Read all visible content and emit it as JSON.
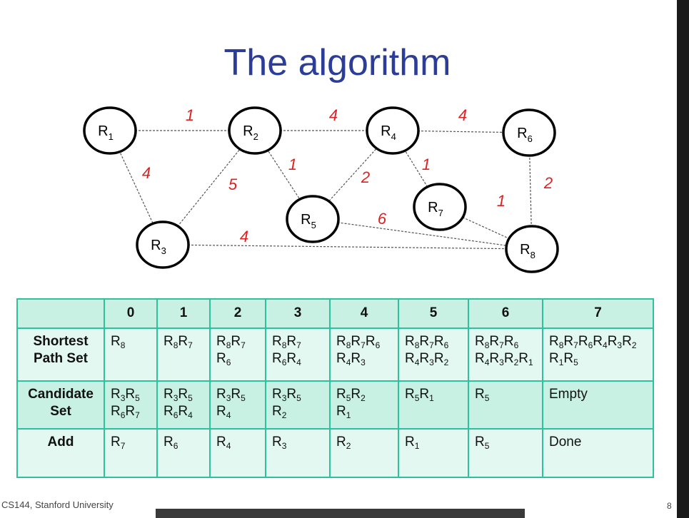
{
  "slide": {
    "title": "The algorithm",
    "footer_left": "CS144, Stanford University",
    "page_number": "8"
  },
  "graph": {
    "nodes": [
      {
        "id": "R1",
        "base": "R",
        "sub": "1"
      },
      {
        "id": "R2",
        "base": "R",
        "sub": "2"
      },
      {
        "id": "R3",
        "base": "R",
        "sub": "3"
      },
      {
        "id": "R4",
        "base": "R",
        "sub": "4"
      },
      {
        "id": "R5",
        "base": "R",
        "sub": "5"
      },
      {
        "id": "R6",
        "base": "R",
        "sub": "6"
      },
      {
        "id": "R7",
        "base": "R",
        "sub": "7"
      },
      {
        "id": "R8",
        "base": "R",
        "sub": "8"
      }
    ],
    "edges": [
      {
        "from": "R1",
        "to": "R2",
        "weight": "1"
      },
      {
        "from": "R1",
        "to": "R3",
        "weight": "4"
      },
      {
        "from": "R2",
        "to": "R3",
        "weight": "5"
      },
      {
        "from": "R2",
        "to": "R4",
        "weight": "4"
      },
      {
        "from": "R2",
        "to": "R5",
        "weight": "1"
      },
      {
        "from": "R3",
        "to": "R8",
        "weight": "4"
      },
      {
        "from": "R4",
        "to": "R5",
        "weight": "2"
      },
      {
        "from": "R4",
        "to": "R6",
        "weight": "4"
      },
      {
        "from": "R4",
        "to": "R7",
        "weight": "1"
      },
      {
        "from": "R5",
        "to": "R8",
        "weight": "6"
      },
      {
        "from": "R6",
        "to": "R8",
        "weight": "2"
      },
      {
        "from": "R7",
        "to": "R8",
        "weight": "1"
      }
    ]
  },
  "table": {
    "columns": [
      "0",
      "1",
      "2",
      "3",
      "4",
      "5",
      "6",
      "7"
    ],
    "rows": [
      {
        "label": [
          "Shortest",
          "Path Set"
        ],
        "cells": [
          [
            [
              "R8"
            ]
          ],
          [
            [
              "R8",
              "R7"
            ]
          ],
          [
            [
              "R8",
              "R7"
            ],
            [
              "R6"
            ]
          ],
          [
            [
              "R8",
              "R7"
            ],
            [
              "R6",
              "R4"
            ]
          ],
          [
            [
              "R8",
              "R7",
              "R6"
            ],
            [
              "R4",
              "R3"
            ]
          ],
          [
            [
              "R8",
              "R7",
              "R6"
            ],
            [
              "R4",
              "R3",
              "R2"
            ]
          ],
          [
            [
              "R8",
              "R7",
              "R6"
            ],
            [
              "R4",
              "R3",
              "R2",
              "R1"
            ]
          ],
          [
            [
              "R8",
              "R7",
              "R6",
              "R4",
              "R3",
              "R2"
            ],
            [
              "R1",
              "R5"
            ]
          ]
        ]
      },
      {
        "label": [
          "Candidate",
          "Set"
        ],
        "cells": [
          [
            [
              "R3",
              "R5"
            ],
            [
              "R6",
              "R7"
            ]
          ],
          [
            [
              "R3",
              "R5"
            ],
            [
              "R6",
              "R4"
            ]
          ],
          [
            [
              "R3",
              "R5"
            ],
            [
              "R4"
            ]
          ],
          [
            [
              "R3",
              "R5"
            ],
            [
              "R2"
            ]
          ],
          [
            [
              "R5",
              "R2"
            ],
            [
              "R1"
            ]
          ],
          [
            [
              "R5",
              "R1"
            ]
          ],
          [
            [
              "R5"
            ]
          ],
          [
            [
              "Empty"
            ]
          ]
        ]
      },
      {
        "label": [
          "Add"
        ],
        "cells": [
          [
            [
              "R7"
            ]
          ],
          [
            [
              "R6"
            ]
          ],
          [
            [
              "R4"
            ]
          ],
          [
            [
              "R3"
            ]
          ],
          [
            [
              "R2"
            ]
          ],
          [
            [
              "R1"
            ]
          ],
          [
            [
              "R5"
            ]
          ],
          [
            [
              "Done"
            ]
          ]
        ]
      }
    ]
  }
}
